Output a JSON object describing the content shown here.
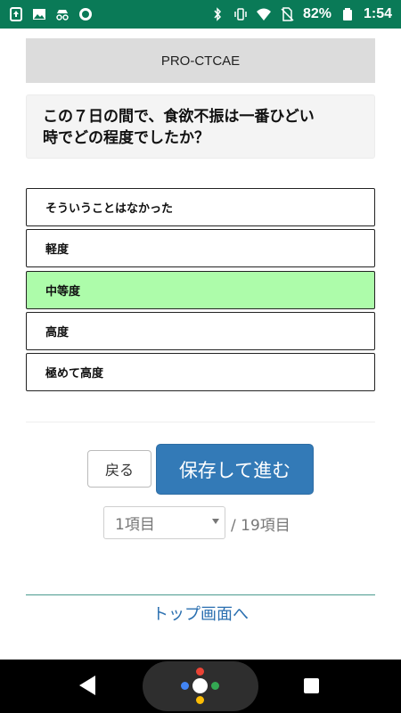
{
  "status_bar": {
    "battery_percent": "82%",
    "time": "1:54",
    "icons_left": [
      "upload-icon",
      "image-icon",
      "incognito-icon",
      "circle-icon"
    ],
    "icons_right": [
      "bluetooth-icon",
      "vibrate-icon",
      "wifi-icon",
      "no-sim-icon",
      "battery-icon"
    ]
  },
  "header": {
    "title": "PRO-CTCAE"
  },
  "question": {
    "line1": "この７日の間で、食欲不振は一番ひどい",
    "line2": "時でどの程度でしたか？"
  },
  "options": [
    {
      "label": "そういうことはなかった",
      "selected": false
    },
    {
      "label": "軽度",
      "selected": false
    },
    {
      "label": "中等度",
      "selected": true
    },
    {
      "label": "高度",
      "selected": false
    },
    {
      "label": "極めて高度",
      "selected": false
    }
  ],
  "buttons": {
    "back_label": "戻る",
    "save_label": "保存して進む"
  },
  "pager": {
    "current": "1項目",
    "total": "/ 19項目"
  },
  "top_link": "トップ画面へ",
  "colors": {
    "status_bar": "#0a7a57",
    "selected_option": "#adfcaa",
    "primary_button": "#337ab7",
    "link": "#2a6fb0"
  }
}
